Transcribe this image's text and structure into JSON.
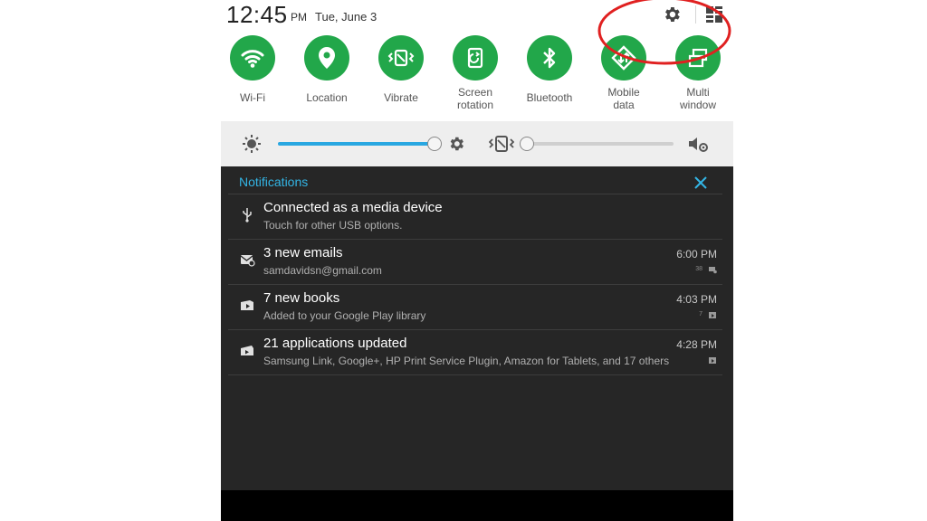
{
  "status_bar": {
    "time": "12:45",
    "ampm": "PM",
    "date": "Tue, June 3",
    "settings_icon": "gear-icon",
    "grid_icon": "grid-icon"
  },
  "quick_toggles": [
    {
      "label": "Wi-Fi",
      "icon": "wifi-icon",
      "active": true
    },
    {
      "label": "Location",
      "icon": "location-icon",
      "active": true
    },
    {
      "label": "Vibrate",
      "icon": "vibrate-icon",
      "active": true
    },
    {
      "label": "Screen\nrotation",
      "icon": "screen-rotation-icon",
      "active": true
    },
    {
      "label": "Bluetooth",
      "icon": "bluetooth-icon",
      "active": true
    },
    {
      "label": "Mobile\ndata",
      "icon": "mobile-data-icon",
      "active": true
    },
    {
      "label": "Multi\nwindow",
      "icon": "multi-window-icon",
      "active": true
    }
  ],
  "sliders": {
    "brightness_level": 0.97,
    "volume_level": 0.0
  },
  "notifications": {
    "header": "Notifications",
    "items": [
      {
        "title": "Connected as a media device",
        "subtitle": "Touch for other USB options.",
        "time": "",
        "count": "",
        "icon": "usb-icon"
      },
      {
        "title": "3 new emails",
        "subtitle": "samdavidsn@gmail.com",
        "time": "6:00 PM",
        "count": "38",
        "icon": "email-icon"
      },
      {
        "title": "7 new books",
        "subtitle": "Added to your Google Play library",
        "time": "4:03 PM",
        "count": "7",
        "icon": "play-books-icon"
      },
      {
        "title": "21 applications updated",
        "subtitle": "Samsung Link, Google+, HP Print Service Plugin, Amazon for Tablets, and 17 others",
        "time": "4:28 PM",
        "count": "",
        "icon": "play-store-icon"
      }
    ]
  },
  "colors": {
    "toggle_active": "#22a74a",
    "accent": "#33b5e5",
    "annotation": "#e02020"
  }
}
